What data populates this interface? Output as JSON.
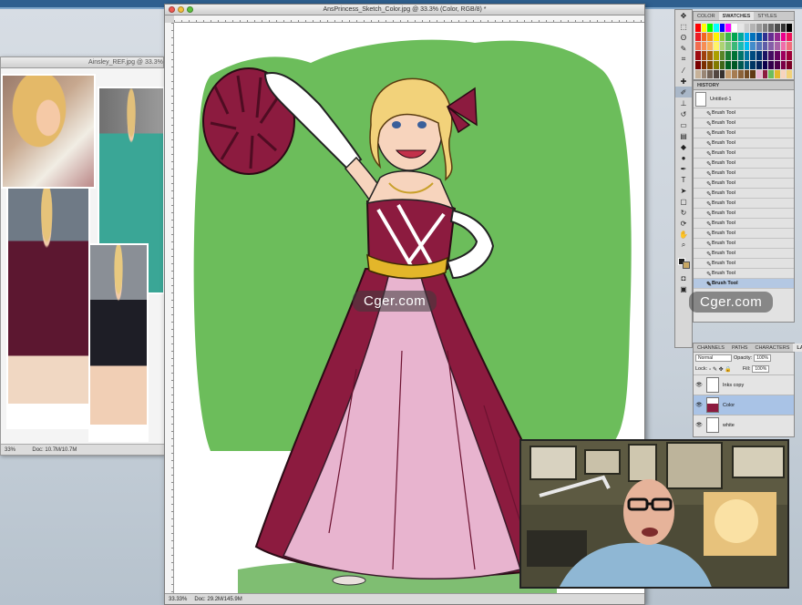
{
  "reference_window": {
    "title": "Ainsley_REF.jpg @ 33.3%",
    "status_zoom": "33%",
    "status_doc": "Doc: 10.7M/10.7M"
  },
  "main_window": {
    "title": "AnsPrincess_Sketch_Color.jpg @ 33.3% (Color, RGB/8) *",
    "status_zoom": "33.33%",
    "status_doc": "Doc: 29.2M/145.9M"
  },
  "swatch_panel": {
    "tabs": [
      "COLOR",
      "SWATCHES",
      "STYLES"
    ],
    "active_tab": "SWATCHES"
  },
  "history_panel": {
    "header": "HISTORY",
    "snapshot": "Untitled-1",
    "states": [
      "Brush Tool",
      "Brush Tool",
      "Brush Tool",
      "Brush Tool",
      "Brush Tool",
      "Brush Tool",
      "Brush Tool",
      "Brush Tool",
      "Brush Tool",
      "Brush Tool",
      "Brush Tool",
      "Brush Tool",
      "Brush Tool",
      "Brush Tool",
      "Brush Tool",
      "Brush Tool",
      "Brush Tool",
      "Brush Tool"
    ],
    "selected_index": 17
  },
  "layers_panel": {
    "tabs": [
      "CHANNELS",
      "PATHS",
      "CHARACTERS",
      "LAYERS"
    ],
    "active_tab": "LAYERS",
    "blend_mode": "Normal",
    "opacity_label": "Opacity:",
    "opacity_value": "100%",
    "lock_label": "Lock:",
    "fill_label": "Fill:",
    "fill_value": "100%",
    "layers": [
      {
        "name": "Inks copy",
        "selected": false
      },
      {
        "name": "Color",
        "selected": true
      },
      {
        "name": "white",
        "selected": false
      }
    ]
  },
  "watermark": {
    "text": "Cger.com"
  },
  "colors": {
    "background_green": "#6cbd5b",
    "dress_burgundy": "#8c1b3f",
    "dress_pink": "#e8b4cf",
    "belt_gold": "#e3b62a",
    "skin": "#f7d4bd",
    "hair": "#f2d27a",
    "selection_blue": "#b4c8e3"
  }
}
